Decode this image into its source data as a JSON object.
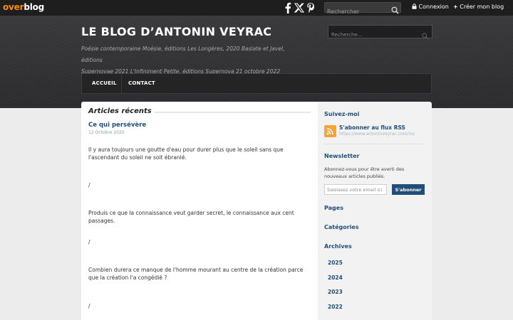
{
  "topbar": {
    "logo_part1": "over",
    "logo_part2": "blog",
    "search_placeholder": "Rechercher",
    "login_label": "Connexion",
    "create_label": "Créer mon blog",
    "social_icons": [
      "facebook-icon",
      "x-twitter-icon",
      "pinterest-icon"
    ]
  },
  "header": {
    "title": "LE BLOG D’ANTONIN VEYRAC",
    "description_line1": "Poésie contemporaine Moésie, éditions Les Longères, 2020 Baslate et Javel, éditions",
    "description_line2": "Supernovae 2021 L'Infiniment Petite, éditions Supernova 21 octobre 2022",
    "search_placeholder": "Recherche..."
  },
  "nav": {
    "items": [
      "ACCUEIL",
      "CONTACT"
    ]
  },
  "main": {
    "section_title": "Articles récents",
    "post": {
      "title": "Ce qui persévère",
      "date": "12 Octobre 2025",
      "paragraphs": [
        "Il y aura toujours une goutte d'eau pour durer plus que le soleil sans que l'ascendant du soleil ne soit ébranlé.",
        "/",
        "Produis ce que la connaissance veut garder secret, le connaissance aux cent passages.",
        "/",
        "Combien durera ce manque de l'homme mourant au centre de la création parce que la création l'a congédié ?",
        "/"
      ]
    }
  },
  "sidebar": {
    "follow_title": "Suivez-moi",
    "rss_title": "S'abonner au flux RSS",
    "rss_url": "https://www.antoninveyrac.com/rss",
    "newsletter_title": "Newsletter",
    "newsletter_text": "Abonnez-vous pour être averti des nouveaux articles publiés.",
    "newsletter_placeholder": "Saisissez votre email ici",
    "subscribe_label": "S'abonner",
    "pages_title": "Pages",
    "categories_title": "Catégories",
    "archives_title": "Archives",
    "years": [
      "2025",
      "2024",
      "2023",
      "2022"
    ]
  },
  "colors": {
    "accent": "#1f4e79",
    "overblog_orange": "#ff8a00",
    "rss_orange": "#f4a43a",
    "header_bg": "#333335"
  }
}
